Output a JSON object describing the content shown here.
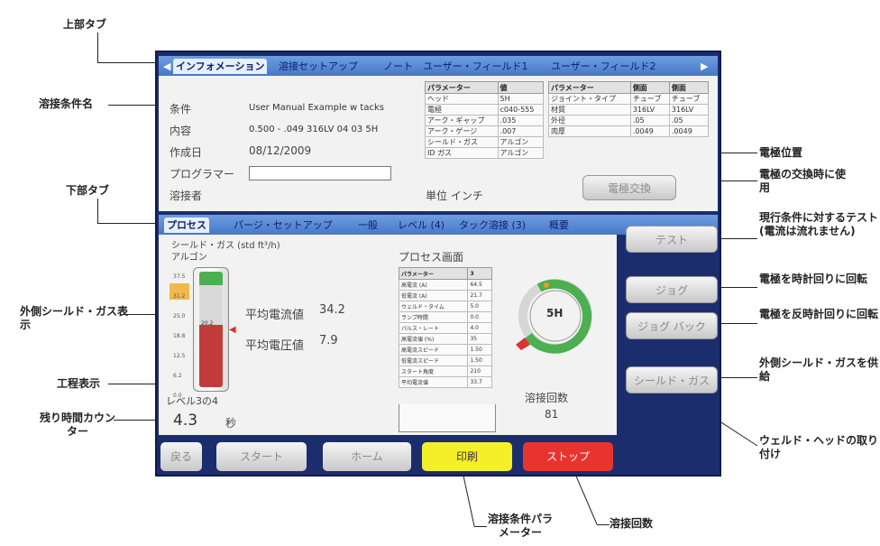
{
  "screen": {
    "top_tabs": [
      "インフォメーション",
      "溶接セットアップ",
      "ノート",
      "ユーザー・フィールド1",
      "ユーザー・フィールド2"
    ],
    "info": {
      "rows": [
        {
          "label": "条件",
          "value": "User Manual Example w tacks"
        },
        {
          "label": "内容",
          "value": "0.500 - .049 316LV 04 03 5H"
        },
        {
          "label": "作成日",
          "value": "08/12/2009"
        },
        {
          "label": "プログラマー",
          "value": ""
        },
        {
          "label": "溶接者",
          "value": ""
        }
      ],
      "unit_label": "単位 インチ",
      "param_table": {
        "headers": [
          "パラメーター",
          "値"
        ],
        "rows": [
          [
            "ヘッド",
            "5H"
          ],
          [
            "電極",
            "c040-555"
          ],
          [
            "アーク・ギャップ",
            ".035"
          ],
          [
            "アーク・ゲージ",
            ".007"
          ],
          [
            "シールド・ガス",
            "アルゴン"
          ],
          [
            "ID ガス",
            "アルゴン"
          ]
        ]
      },
      "side_table": {
        "headers": [
          "パラメーター",
          "側面",
          "側面"
        ],
        "rows": [
          [
            "ジョイント・タイプ",
            "チューブ",
            "チューブ"
          ],
          [
            "材質",
            "316LV",
            "316LV"
          ],
          [
            "外径",
            ".05",
            ".05"
          ],
          [
            "肉厚",
            ".0049",
            ".0049"
          ]
        ]
      },
      "electrode_button": "電極交換"
    },
    "bottom_tabs": [
      "プロセス",
      "パージ・セットアップ",
      "一般",
      "レベル (4)",
      "タック溶接 (3)",
      "概要"
    ],
    "process": {
      "gas_label": "シールド・ガス (std ft³/h)",
      "gas_type": "アルゴン",
      "gauge_ticks": [
        "37.5",
        "31.2",
        "25.0",
        "18.8",
        "12.5",
        "6.2",
        "0.0"
      ],
      "gauge_value_label": "20.2",
      "gauge_level": 0.54,
      "avg_current_label": "平均電流値",
      "avg_current_value": "34.2",
      "avg_voltage_label": "平均電圧値",
      "avg_voltage_value": "7.9",
      "screen_title": "プロセス画面",
      "level_text": "レベル3の4",
      "remaining_value": "4.3",
      "remaining_unit": "秒",
      "proc_table": {
        "headers": [
          "パラメーター",
          "3"
        ],
        "rows": [
          [
            "高電流 (A)",
            "64.5"
          ],
          [
            "低電流 (A)",
            "21.7"
          ],
          [
            "ウェルド・タイム",
            "5.0"
          ],
          [
            "ランプ時間",
            "0.0"
          ],
          [
            "パルス・レート",
            "4.0"
          ],
          [
            "高電流値 (%)",
            "35"
          ],
          [
            "高電流スピード",
            "1.50"
          ],
          [
            "低電流スピード",
            "1.50"
          ],
          [
            "スタート角度",
            "210"
          ],
          [
            "平均電流値",
            "33.7"
          ]
        ]
      },
      "head_label": "5H",
      "weld_count_label": "溶接回数",
      "weld_count_value": "81"
    },
    "right_buttons": [
      "テスト",
      "ジョグ",
      "ジョグ バック",
      "シールド・ガス"
    ],
    "bottom_buttons": [
      "戻る",
      "スタート",
      "ホーム",
      "印刷",
      "ストップ"
    ]
  },
  "callouts": {
    "top_tab": "上部タブ",
    "condition_name": "溶接条件名",
    "bottom_tab": "下部タブ",
    "outer_gas": "外側シールド・ガス表示",
    "process_display": "工程表示",
    "remaining_counter": "残り時間カウンター",
    "electrode_position": "電極位置",
    "electrode_change": "電極の交換時に使用",
    "test": "現行条件に対するテスト (電流は流れません)",
    "jog_cw": "電極を時計回りに回転",
    "jog_ccw": "電極を反時計回りに回転",
    "supply_gas": "外側シールド・ガスを供給",
    "weld_head": "ウェルド・ヘッドの取り付け",
    "weld_params": "溶接条件パラメーター",
    "weld_count": "溶接回数"
  },
  "colors": {
    "print": "#f5ef2a",
    "stop": "#e8342e",
    "screen_border": "#1c2d6e",
    "gauge_green": "#4caf50",
    "gauge_red": "#c33a3a"
  }
}
